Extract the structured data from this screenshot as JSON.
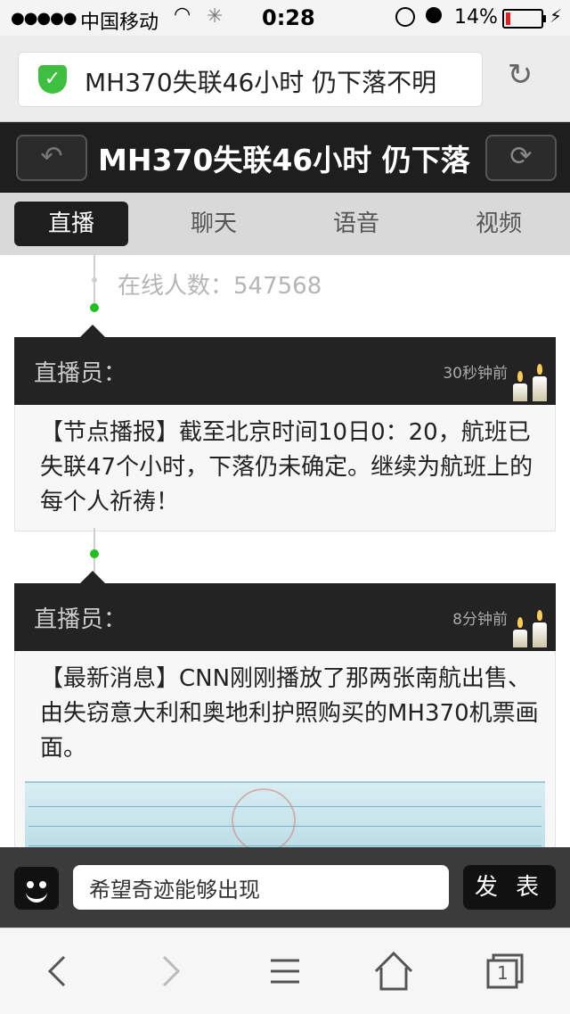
{
  "status_bar": {
    "signal": "●●●●●",
    "carrier": "中国移动",
    "time": "0:28",
    "battery_percent": "14%",
    "battery_level": 0.14
  },
  "url_bar": {
    "page_title": "MH370失联46小时 仍下落不明"
  },
  "header": {
    "title": "MH370失联46小时 仍下落"
  },
  "tabs": [
    {
      "label": "直播",
      "active": true
    },
    {
      "label": "聊天",
      "active": false
    },
    {
      "label": "语音",
      "active": false
    },
    {
      "label": "视频",
      "active": false
    }
  ],
  "feed": {
    "online_label": "在线人数：547568",
    "posts": [
      {
        "role": "直播员：",
        "time": "30秒钟前",
        "text": "【节点播报】截至北京时间10日0：20，航班已失联47个小时，下落仍未确定。继续为航班上的每个人祈祷！"
      },
      {
        "role": "直播员：",
        "time": "8分钟前",
        "text": "【最新消息】CNN刚刚播放了那两张南航出售、由失窃意大利和奥地利护照购买的MH370机票画面。"
      }
    ]
  },
  "comment": {
    "value": "希望奇迹能够出现",
    "send_label": "发 表"
  },
  "toolbar": {
    "tabs_count": "1"
  },
  "colors": {
    "accent_green": "#1fc11f",
    "header_dark": "#1e1e1e",
    "battery_red": "#e02020"
  }
}
